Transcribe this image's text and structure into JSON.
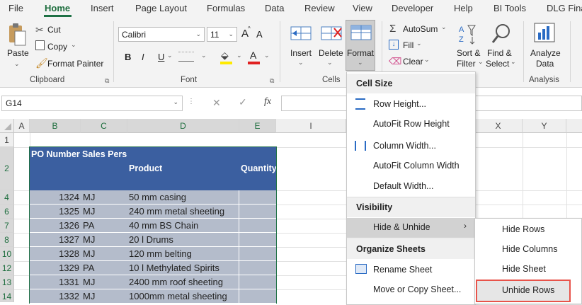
{
  "tabs": [
    "File",
    "Home",
    "Insert",
    "Page Layout",
    "Formulas",
    "Data",
    "Review",
    "View",
    "Developer",
    "Help",
    "BI Tools",
    "DLG Fina"
  ],
  "clipboard": {
    "paste": "Paste",
    "cut": "Cut",
    "copy": "Copy",
    "format_painter": "Format Painter",
    "group": "Clipboard"
  },
  "font": {
    "name": "Calibri",
    "size": "11",
    "bold": "B",
    "italic": "I",
    "underline": "U",
    "grow": "A",
    "shrink": "A",
    "font_color_letter": "A",
    "group": "Font"
  },
  "cells_group": {
    "insert": "Insert",
    "delete": "Delete",
    "format": "Format",
    "group": "Cells"
  },
  "editing": {
    "autosum": "AutoSum",
    "fill": "Fill",
    "clear": "Clear",
    "sort": "Sort &",
    "filter": "Filter",
    "find": "Find &",
    "select": "Select"
  },
  "analysis": {
    "analyze": "Analyze",
    "data": "Data",
    "group": "Analysis"
  },
  "name_box": "G14",
  "fx": "fx",
  "columns": [
    "A",
    "B",
    "C",
    "D",
    "E",
    "I",
    "X",
    "Y"
  ],
  "rows": [
    "1",
    "2",
    "4",
    "6",
    "7",
    "8",
    "10",
    "12",
    "13",
    "14"
  ],
  "table": {
    "headers": {
      "po": "PO Number",
      "sales": "Sales Pers",
      "product": "Product",
      "quantity": "Quantity"
    },
    "data": [
      {
        "po": "1324",
        "sp": "MJ",
        "product": "50 mm casing"
      },
      {
        "po": "1325",
        "sp": "MJ",
        "product": "240 mm metal sheeting"
      },
      {
        "po": "1326",
        "sp": "PA",
        "product": "40 mm BS Chain"
      },
      {
        "po": "1327",
        "sp": "MJ",
        "product": "20 l Drums"
      },
      {
        "po": "1328",
        "sp": "MJ",
        "product": "120 mm belting"
      },
      {
        "po": "1329",
        "sp": "PA",
        "product": "10 l Methylated Spirits"
      },
      {
        "po": "1331",
        "sp": "MJ",
        "product": "2400 mm roof sheeting"
      },
      {
        "po": "1332",
        "sp": "MJ",
        "product": "1000mm metal sheeting"
      }
    ]
  },
  "format_menu": {
    "cell_size": "Cell Size",
    "row_height": "Row Height...",
    "autofit_row": "AutoFit Row Height",
    "column_width": "Column Width...",
    "autofit_col": "AutoFit Column Width",
    "default_width": "Default Width...",
    "visibility": "Visibility",
    "hide_unhide": "Hide & Unhide",
    "organize": "Organize Sheets",
    "rename": "Rename Sheet",
    "move_copy": "Move or Copy Sheet..."
  },
  "submenu": {
    "hide_rows": "Hide Rows",
    "hide_columns": "Hide Columns",
    "hide_sheet": "Hide Sheet",
    "unhide_rows": "Unhide Rows"
  },
  "colors": {
    "accent_green": "#1e7145",
    "table_header": "#3b5fa0",
    "row_fill": "#b4bccb",
    "highlight_red": "#e8534a"
  }
}
